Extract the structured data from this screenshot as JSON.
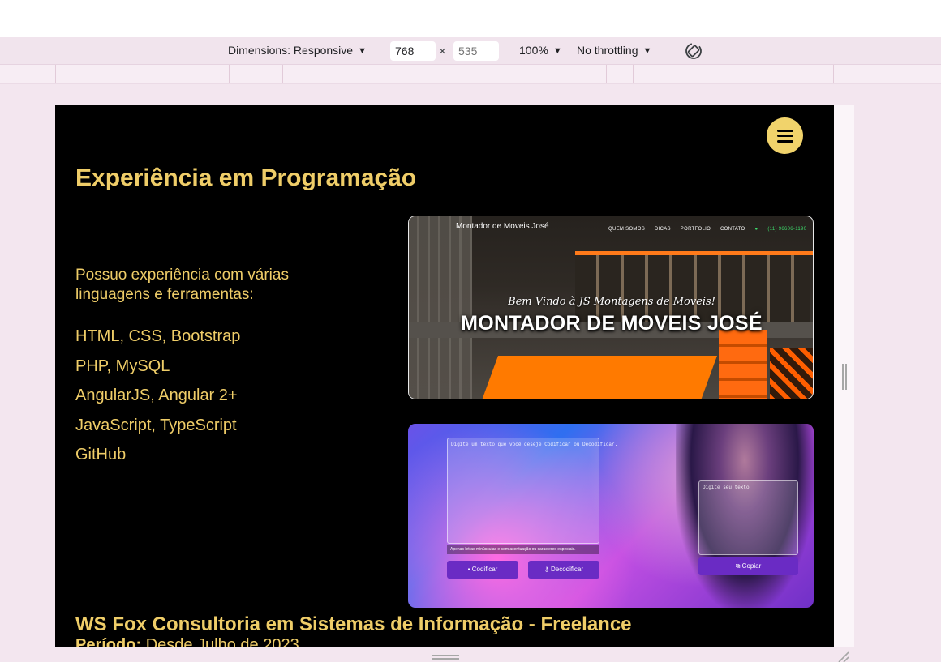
{
  "devtools": {
    "dimensions_label": "Dimensions: Responsive",
    "width_value": "768",
    "height_placeholder": "535",
    "times_symbol": "×",
    "zoom": "100%",
    "throttling": "No throttling",
    "caret": "▼"
  },
  "page": {
    "section_title": "Experiência em Programação",
    "intro": "Possuo experiência com várias linguagens e ferramentas:",
    "skills": [
      "HTML, CSS, Bootstrap",
      "PHP, MySQL",
      "AngularJS, Angular 2+",
      "JavaScript, TypeScript",
      "GitHub"
    ],
    "job_title": "WS Fox Consultoria em Sistemas de Informação - Freelance",
    "period_label": "Período:",
    "period_value": "Desde Julho de 2023"
  },
  "project1": {
    "brand": "Montador de Moveis José",
    "menu": [
      "QUEM SOMOS",
      "DICAS",
      "PORTFOLIO",
      "CONTATO"
    ],
    "phone": "(11) 96606-1190",
    "welcome": "Bem Vindo à JS Montagens de Moveis!",
    "headline": "MONTADOR DE MOVEIS JOSÉ"
  },
  "project2": {
    "placeholder_main": "Digite um texto que você deseje Codificar ou Decodificar.",
    "placeholder_side": "Digite seu texto",
    "note": "Apenas letras minúsculas e sem acentuação ou caracteres especiais.",
    "encode_label": "Codificar",
    "decode_label": "Decodificar",
    "copy_label": "Copiar"
  },
  "colors": {
    "accent_gold": "#efcd68",
    "menu_button": "#f1d36b",
    "page_background": "#000000",
    "devtools_background": "#f1e4ed"
  },
  "icons": [
    "caret-down-icon",
    "rotate-icon",
    "hamburger-menu-icon",
    "whatsapp-icon",
    "lock-icon",
    "key-icon",
    "copy-icon"
  ]
}
